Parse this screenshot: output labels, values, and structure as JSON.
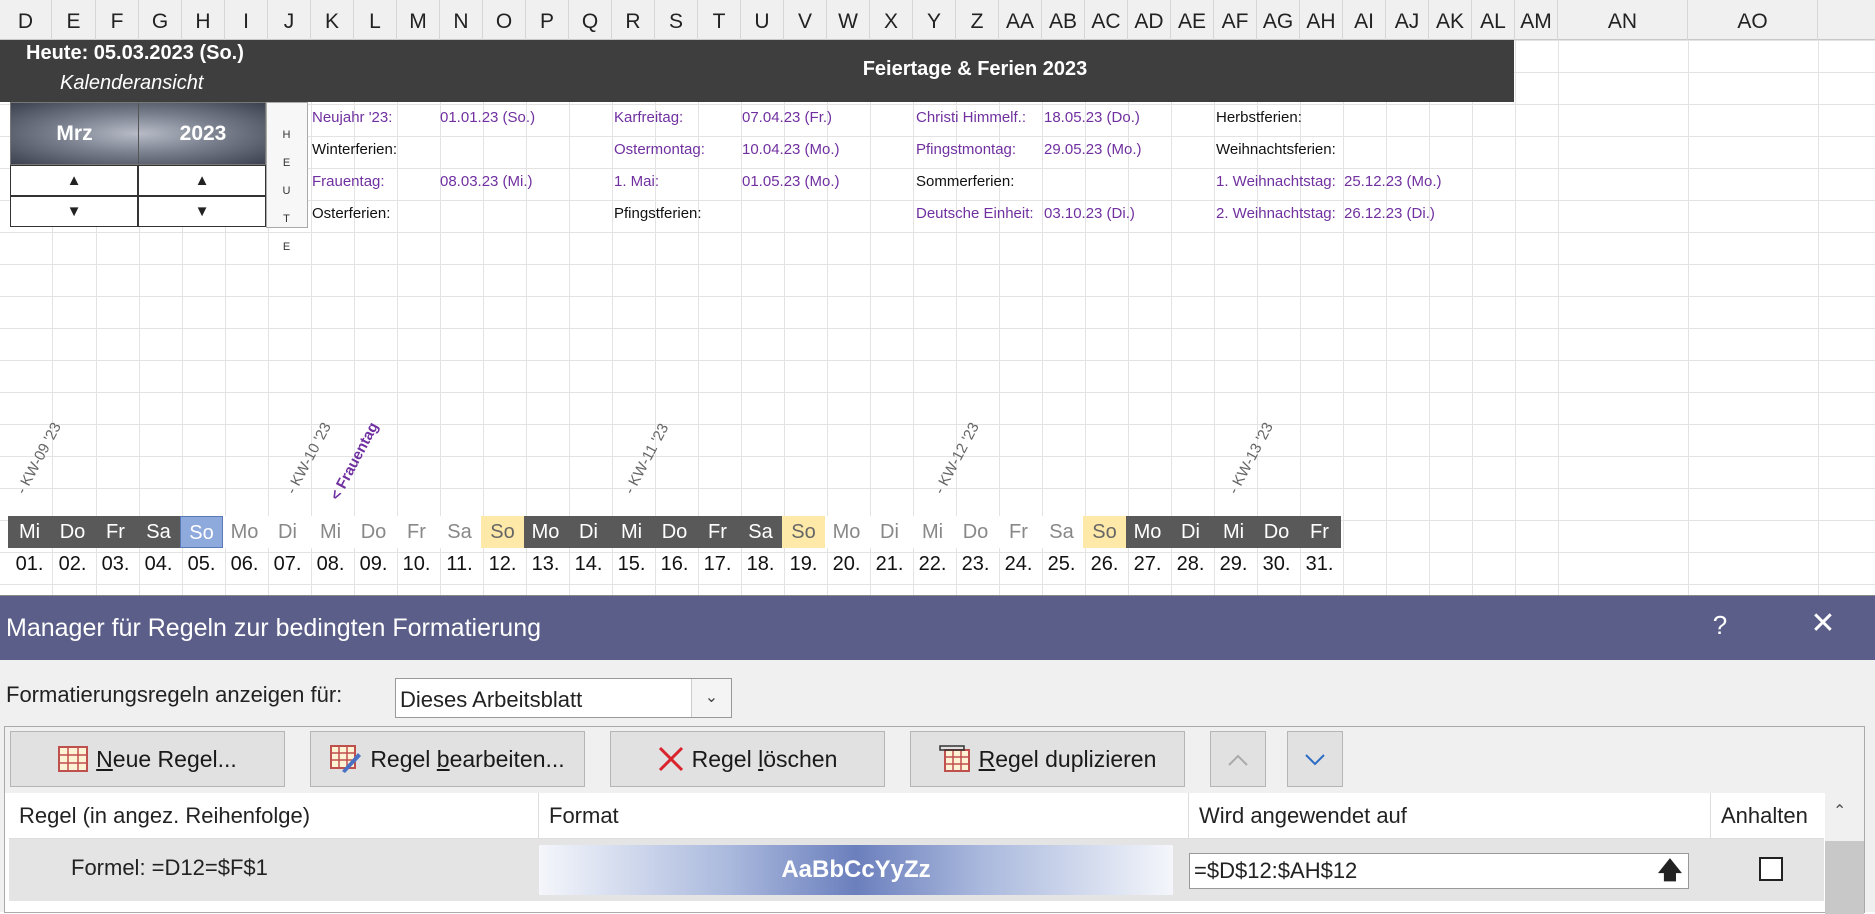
{
  "sheet": {
    "columns": [
      "D",
      "E",
      "F",
      "G",
      "H",
      "I",
      "J",
      "K",
      "L",
      "M",
      "N",
      "O",
      "P",
      "Q",
      "R",
      "S",
      "T",
      "U",
      "V",
      "W",
      "X",
      "Y",
      "Z",
      "AA",
      "AB",
      "AC",
      "AD",
      "AE",
      "AF",
      "AG",
      "AH",
      "AI",
      "AJ",
      "AK",
      "AL",
      "AM",
      "AN",
      "AO"
    ],
    "today_label": "Heute: 05.03.2023 (So.)",
    "calendar_view": "Kalenderansicht",
    "banner_title": "Feiertage & Ferien 2023",
    "picker": {
      "month": "Mrz",
      "year": "2023",
      "up": "▲",
      "down": "▼"
    },
    "heute_letters": [
      "H",
      "E",
      "U",
      "T",
      "E"
    ],
    "holidays": [
      {
        "label": "Neujahr '23:",
        "value": "01.01.23 (So.)",
        "purple": true
      },
      {
        "label": "Winterferien:",
        "value": "",
        "purple": false
      },
      {
        "label": "Frauentag:",
        "value": "08.03.23 (Mi.)",
        "purple": true
      },
      {
        "label": "Osterferien:",
        "value": "",
        "purple": false
      },
      {
        "label": "Karfreitag:",
        "value": "07.04.23 (Fr.)",
        "purple": true
      },
      {
        "label": "Ostermontag:",
        "value": "10.04.23 (Mo.)",
        "purple": true
      },
      {
        "label": "1. Mai:",
        "value": "01.05.23 (Mo.)",
        "purple": true
      },
      {
        "label": "Pfingstferien:",
        "value": "",
        "purple": false
      },
      {
        "label": "Christi Himmelf.:",
        "value": "18.05.23 (Do.)",
        "purple": true
      },
      {
        "label": "Pfingstmontag:",
        "value": "29.05.23 (Mo.)",
        "purple": true
      },
      {
        "label": "Sommerferien:",
        "value": "",
        "purple": false
      },
      {
        "label": "Deutsche Einheit:",
        "value": "03.10.23 (Di.)",
        "purple": true
      },
      {
        "label": "Herbstferien:",
        "value": "",
        "purple": false
      },
      {
        "label": "Weihnachtsferien:",
        "value": "",
        "purple": false
      },
      {
        "label": "1. Weihnachtstag:",
        "value": "25.12.23 (Mo.)",
        "purple": true
      },
      {
        "label": "2. Weihnachtstag:",
        "value": "26.12.23 (Di.)",
        "purple": true
      }
    ],
    "week_labels": [
      "- KW-09 '23",
      "- KW-10 '23",
      "- KW-11 '23",
      "- KW-12 '23",
      "- KW-13 '23"
    ],
    "frauentag_marker": "< Frauentag",
    "weekdays": [
      "Mi",
      "Do",
      "Fr",
      "Sa",
      "So",
      "Mo",
      "Di",
      "Mi",
      "Do",
      "Fr",
      "Sa",
      "So",
      "Mo",
      "Di",
      "Mi",
      "Do",
      "Fr",
      "Sa",
      "So",
      "Mo",
      "Di",
      "Mi",
      "Do",
      "Fr",
      "Sa",
      "So",
      "Mo",
      "Di",
      "Mi",
      "Do",
      "Fr"
    ],
    "day_numbers": [
      "01.",
      "02.",
      "03.",
      "04.",
      "05.",
      "06.",
      "07.",
      "08.",
      "09.",
      "10.",
      "11.",
      "12.",
      "13.",
      "14.",
      "15.",
      "16.",
      "17.",
      "18.",
      "19.",
      "20.",
      "21.",
      "22.",
      "23.",
      "24.",
      "25.",
      "26.",
      "27.",
      "28.",
      "29.",
      "30.",
      "31."
    ],
    "colors": {
      "banner": "#3e3e3e",
      "purple": "#7030a0",
      "today_blue": "#8ea9db",
      "sunday_yellow": "#ffe9a8",
      "dark_week": "#595959"
    }
  },
  "dialog": {
    "title": "Manager für Regeln zur bedingten Formatierung",
    "help": "?",
    "close": "✕",
    "show_rules_label": "Formatierungsregeln anzeigen für:",
    "show_rules_value": "Dieses Arbeitsblatt",
    "buttons": {
      "new": "Neue Regel...",
      "edit": "Regel bearbeiten...",
      "delete": "Regel löschen",
      "duplicate": "Regel duplizieren",
      "move_up": "^",
      "move_down": "v"
    },
    "columns": {
      "rule": "Regel (in angez. Reihenfolge)",
      "format": "Format",
      "applies": "Wird angewendet auf",
      "stop": "Anhalten"
    },
    "rule_row": {
      "formula": "Formel: =D12=$F$1",
      "preview": "AaBbCcYyZz",
      "applies_to": "=$D$12:$AH$12",
      "stop_if_true": false
    },
    "title_bar_color": "#5b5e88"
  }
}
